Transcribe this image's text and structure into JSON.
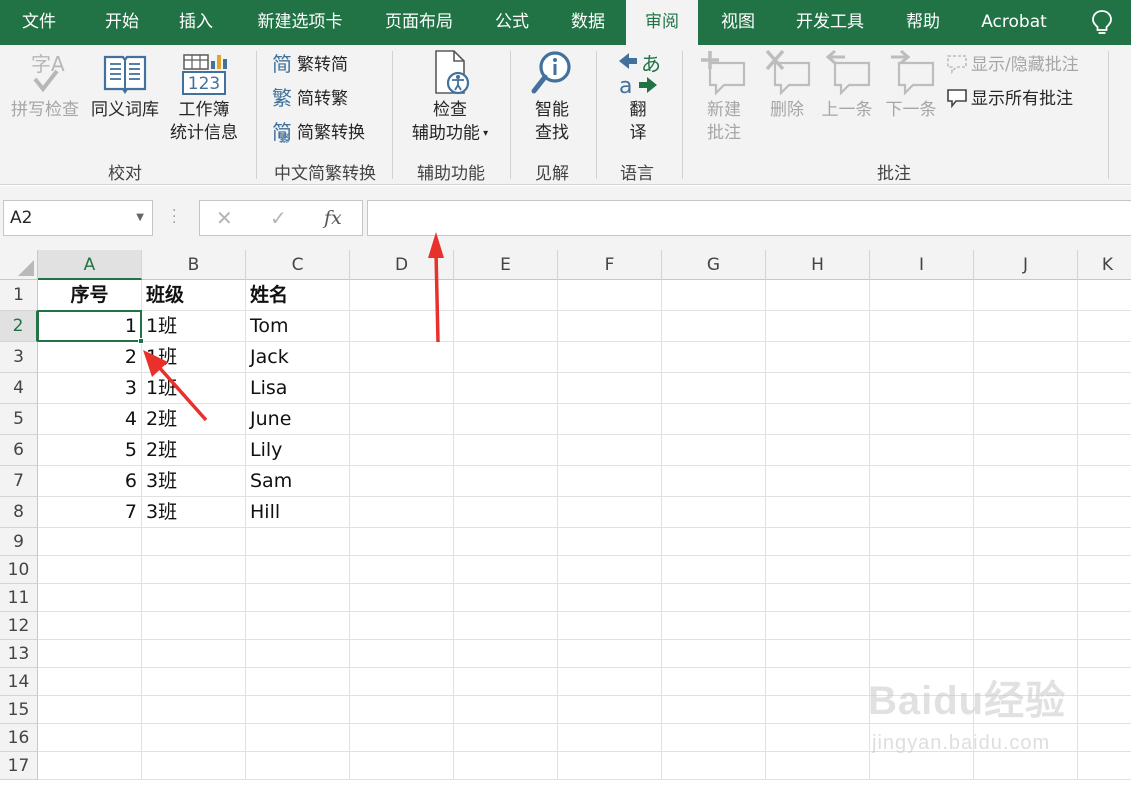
{
  "tabs": [
    {
      "id": "file",
      "label": "文件",
      "active": false
    },
    {
      "id": "home",
      "label": "开始",
      "active": false
    },
    {
      "id": "insert",
      "label": "插入",
      "active": false
    },
    {
      "id": "newtab",
      "label": "新建选项卡",
      "active": false
    },
    {
      "id": "layout",
      "label": "页面布局",
      "active": false
    },
    {
      "id": "formulas",
      "label": "公式",
      "active": false
    },
    {
      "id": "data",
      "label": "数据",
      "active": false
    },
    {
      "id": "review",
      "label": "审阅",
      "active": true
    },
    {
      "id": "view",
      "label": "视图",
      "active": false
    },
    {
      "id": "developer",
      "label": "开发工具",
      "active": false
    },
    {
      "id": "help",
      "label": "帮助",
      "active": false
    },
    {
      "id": "acrobat",
      "label": "Acrobat",
      "active": false
    }
  ],
  "ribbon": {
    "proofing": {
      "label": "校对",
      "spelling": "拼写检查",
      "thesaurus": "同义词库",
      "stats_line1": "工作簿",
      "stats_line2": "统计信息"
    },
    "chinese": {
      "label": "中文简繁转换",
      "to_simplified": "繁转简",
      "to_traditional": "简转繁",
      "convert": "简繁转换"
    },
    "accessibility": {
      "label": "辅助功能",
      "line1": "检查",
      "line2": "辅助功能"
    },
    "insights": {
      "label": "见解",
      "line1": "智能",
      "line2": "查找"
    },
    "language": {
      "label": "语言",
      "line1": "翻",
      "line2": "译"
    },
    "comments": {
      "label": "批注",
      "new_line1": "新建",
      "new_line2": "批注",
      "delete": "删除",
      "previous": "上一条",
      "next": "下一条",
      "show_hide": "显示/隐藏批注",
      "show_all": "显示所有批注"
    }
  },
  "formula_bar": {
    "name_box": "A2",
    "fx": "fx",
    "value": ""
  },
  "sheet": {
    "columns": [
      "A",
      "B",
      "C",
      "D",
      "E",
      "F",
      "G",
      "H",
      "I",
      "J",
      "K"
    ],
    "rows": [
      "1",
      "2",
      "3",
      "4",
      "5",
      "6",
      "7",
      "8",
      "9",
      "10",
      "11",
      "12",
      "13",
      "14",
      "15",
      "16",
      "17"
    ],
    "header": [
      "序号",
      "班级",
      "姓名"
    ],
    "data": [
      [
        "1",
        "1班",
        "Tom"
      ],
      [
        "2",
        "1班",
        "Jack"
      ],
      [
        "3",
        "1班",
        "Lisa"
      ],
      [
        "4",
        "2班",
        "June"
      ],
      [
        "5",
        "2班",
        "Lily"
      ],
      [
        "6",
        "3班",
        "Sam"
      ],
      [
        "7",
        "3班",
        "Hill"
      ]
    ],
    "selected_cell": "A2"
  },
  "watermark": {
    "brand": "Baidu经验",
    "url": "jingyan.baidu.com"
  },
  "colors": {
    "accent": "#217346",
    "arrow": "#e8312a"
  }
}
